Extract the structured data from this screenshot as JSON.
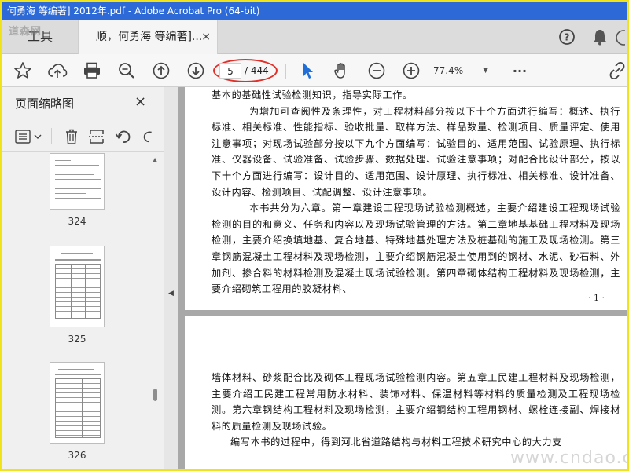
{
  "window": {
    "title": "何勇海 等编著] 2012年.pdf - Adobe Acrobat Pro (64-bit)"
  },
  "tabs": {
    "tools_label": "工具",
    "doc_label": "顺，何勇海 等编著]...",
    "close_glyph": "×",
    "logo_text": "道森网"
  },
  "toolbar": {
    "page_current": "5",
    "page_total": "/ 444",
    "zoom": "77.4%",
    "more": "···"
  },
  "left_panel": {
    "title": "页面缩略图",
    "close_glyph": "×",
    "thumbnails": [
      {
        "label": "324"
      },
      {
        "label": "325"
      },
      {
        "label": "326"
      }
    ]
  },
  "document": {
    "page1_paragraphs": [
      "基本的基础性试验检测知识，指导实际工作。",
      "为增加可查阅性及条理性，对工程材料部分按以下十个方面进行编写：概述、执行标准、相关标准、性能指标、验收批量、取样方法、样品数量、检测项目、质量评定、使用注意事项；对现场试验部分按以下九个方面编写：试验目的、适用范围、试验原理、执行标准、仪器设备、试验准备、试验步骤、数据处理、试验注意事项；对配合比设计部分，按以下十个方面进行编写：设计目的、适用范围、设计原理、执行标准、相关标准、设计准备、设计内容、检测项目、试配调整、设计注意事项。",
      "本书共分为六章。第一章建设工程现场试验检测概述，主要介绍建设工程现场试验检测的目的和意义、任务和内容以及现场试验管理的方法。第二章地基基础工程材料及现场检测，主要介绍换填地基、复合地基、特殊地基处理方法及桩基础的施工及现场检测。第三章钢筋混凝土工程材料及现场检测，主要介绍钢筋混凝土使用到的钢材、水泥、砂石料、外加剂、掺合料的材料检测及混凝土现场试验检测。第四章砌体结构工程材料及现场检测，主要介绍砌筑工程用的胶凝材料、"
    ],
    "page1_number": "· 1 ·",
    "page2_paragraphs": [
      "墙体材料、砂浆配合比及砌体工程现场试验检测内容。第五章工民建工程材料及现场检测，主要介绍工民建工程常用防水材料、装饰材料、保温材料等材料的质量检测及工程现场检测。第六章钢结构工程材料及现场检测，主要介绍钢结构工程用钢材、螺栓连接副、焊接材料的质量检测及现场试验。",
      "编写本书的过程中，得到河北省道路结构与材料工程技术研究中心的大力支"
    ]
  },
  "watermark": {
    "text": "www.cndao.com"
  },
  "colors": {
    "titlebar": "#2d6ad7",
    "frame": "#f1e31a",
    "highlight_ellipse": "#e0302a",
    "select_arrow": "#1f6fd6"
  }
}
